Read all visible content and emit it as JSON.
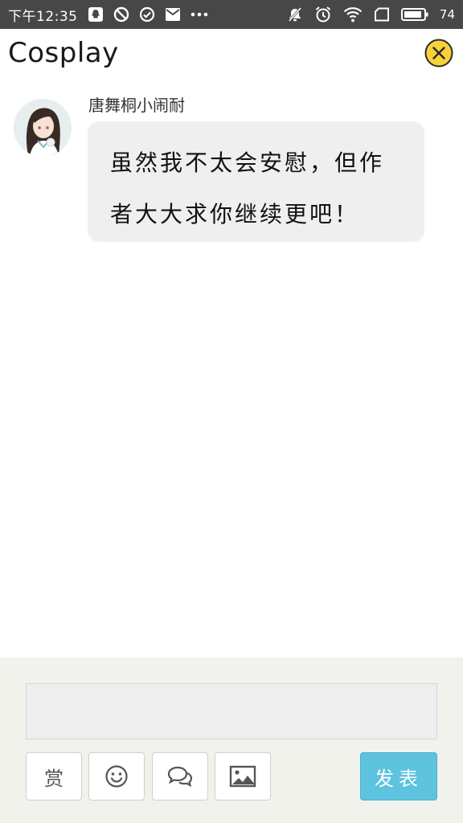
{
  "status_bar": {
    "time": "下午12:35",
    "battery": "74",
    "left_icons": [
      "qq-icon",
      "block-icon",
      "check-icon",
      "mail-icon",
      "more-icon"
    ],
    "right_icons": [
      "mute-icon",
      "alarm-icon",
      "wifi-icon",
      "sim-icon",
      "battery-icon"
    ]
  },
  "header": {
    "title": "Cosplay"
  },
  "message": {
    "username": "唐舞桐小闹耐",
    "text": "虽然我不太会安慰，但作者大大求你继续更吧！"
  },
  "footer": {
    "input_placeholder": "",
    "reward_label": "赏",
    "send_label": "发表"
  },
  "colors": {
    "status_bar": "#474747",
    "bubble": "#efefef",
    "footer": "#f2f2ec",
    "send_button": "#5ec3df",
    "close_icon_fill": "#f8d23a"
  }
}
